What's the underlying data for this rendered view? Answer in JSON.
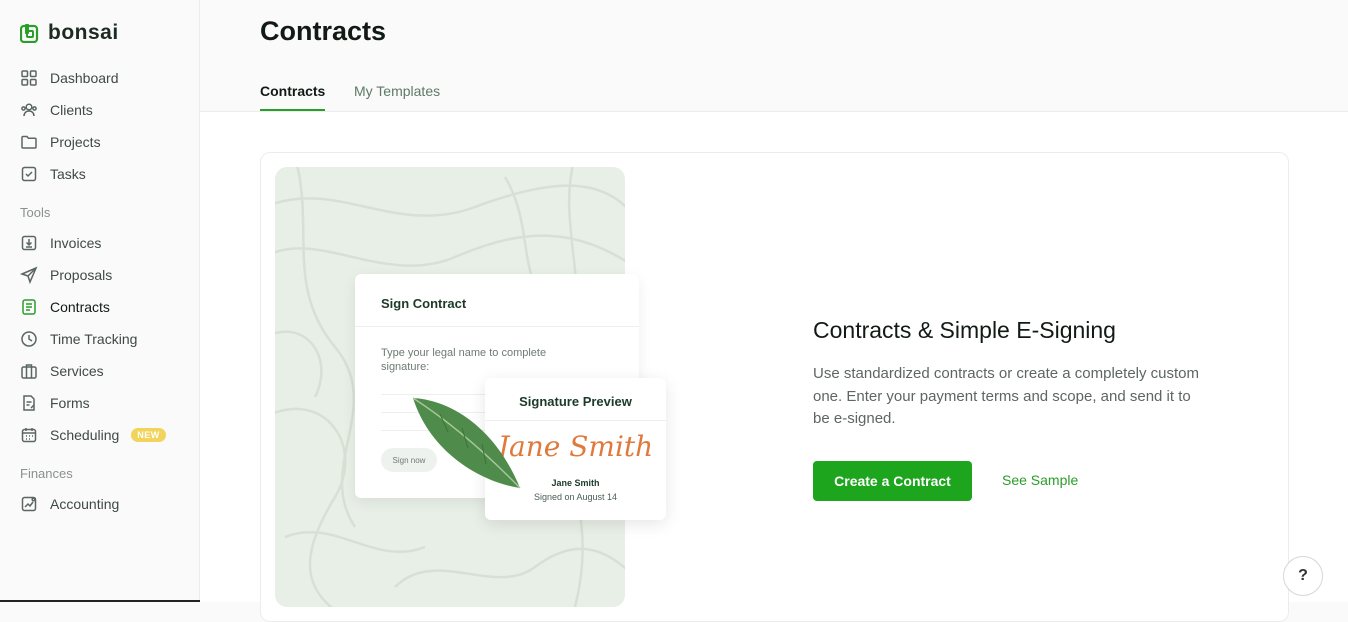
{
  "app": {
    "brand": "bonsai"
  },
  "sidebar": {
    "items": [
      {
        "label": "Dashboard",
        "icon": "dashboard-icon"
      },
      {
        "label": "Clients",
        "icon": "clients-icon"
      },
      {
        "label": "Projects",
        "icon": "folder-icon"
      },
      {
        "label": "Tasks",
        "icon": "tasks-icon"
      }
    ],
    "tools_label": "Tools",
    "tools": [
      {
        "label": "Invoices",
        "icon": "invoice-icon"
      },
      {
        "label": "Proposals",
        "icon": "send-icon"
      },
      {
        "label": "Contracts",
        "icon": "contract-icon"
      },
      {
        "label": "Time Tracking",
        "icon": "clock-icon"
      },
      {
        "label": "Services",
        "icon": "briefcase-icon"
      },
      {
        "label": "Forms",
        "icon": "form-icon"
      },
      {
        "label": "Scheduling",
        "icon": "calendar-icon",
        "badge": "NEW"
      }
    ],
    "finances_label": "Finances",
    "finances": [
      {
        "label": "Accounting",
        "icon": "chart-icon"
      }
    ]
  },
  "header": {
    "title": "Contracts",
    "tabs": [
      {
        "label": "Contracts"
      },
      {
        "label": "My Templates"
      }
    ]
  },
  "illustration": {
    "sign_title": "Sign Contract",
    "sign_instruction": "Type your legal name to complete signature:",
    "sign_button": "Sign now",
    "preview_title": "Signature Preview",
    "preview_signature": "Jane Smith",
    "preview_name": "Jane Smith",
    "preview_date": "Signed on August 14"
  },
  "promo": {
    "headline": "Contracts & Simple E-Signing",
    "description": "Use standardized contracts or create a completely custom one. Enter your payment terms and scope, and send it to be e-signed.",
    "create_button": "Create a Contract",
    "sample_link": "See Sample"
  },
  "help": {
    "label": "?"
  },
  "colors": {
    "accent": "#1ea51e",
    "badge": "#f2d45c",
    "signature": "#e07a3c"
  }
}
